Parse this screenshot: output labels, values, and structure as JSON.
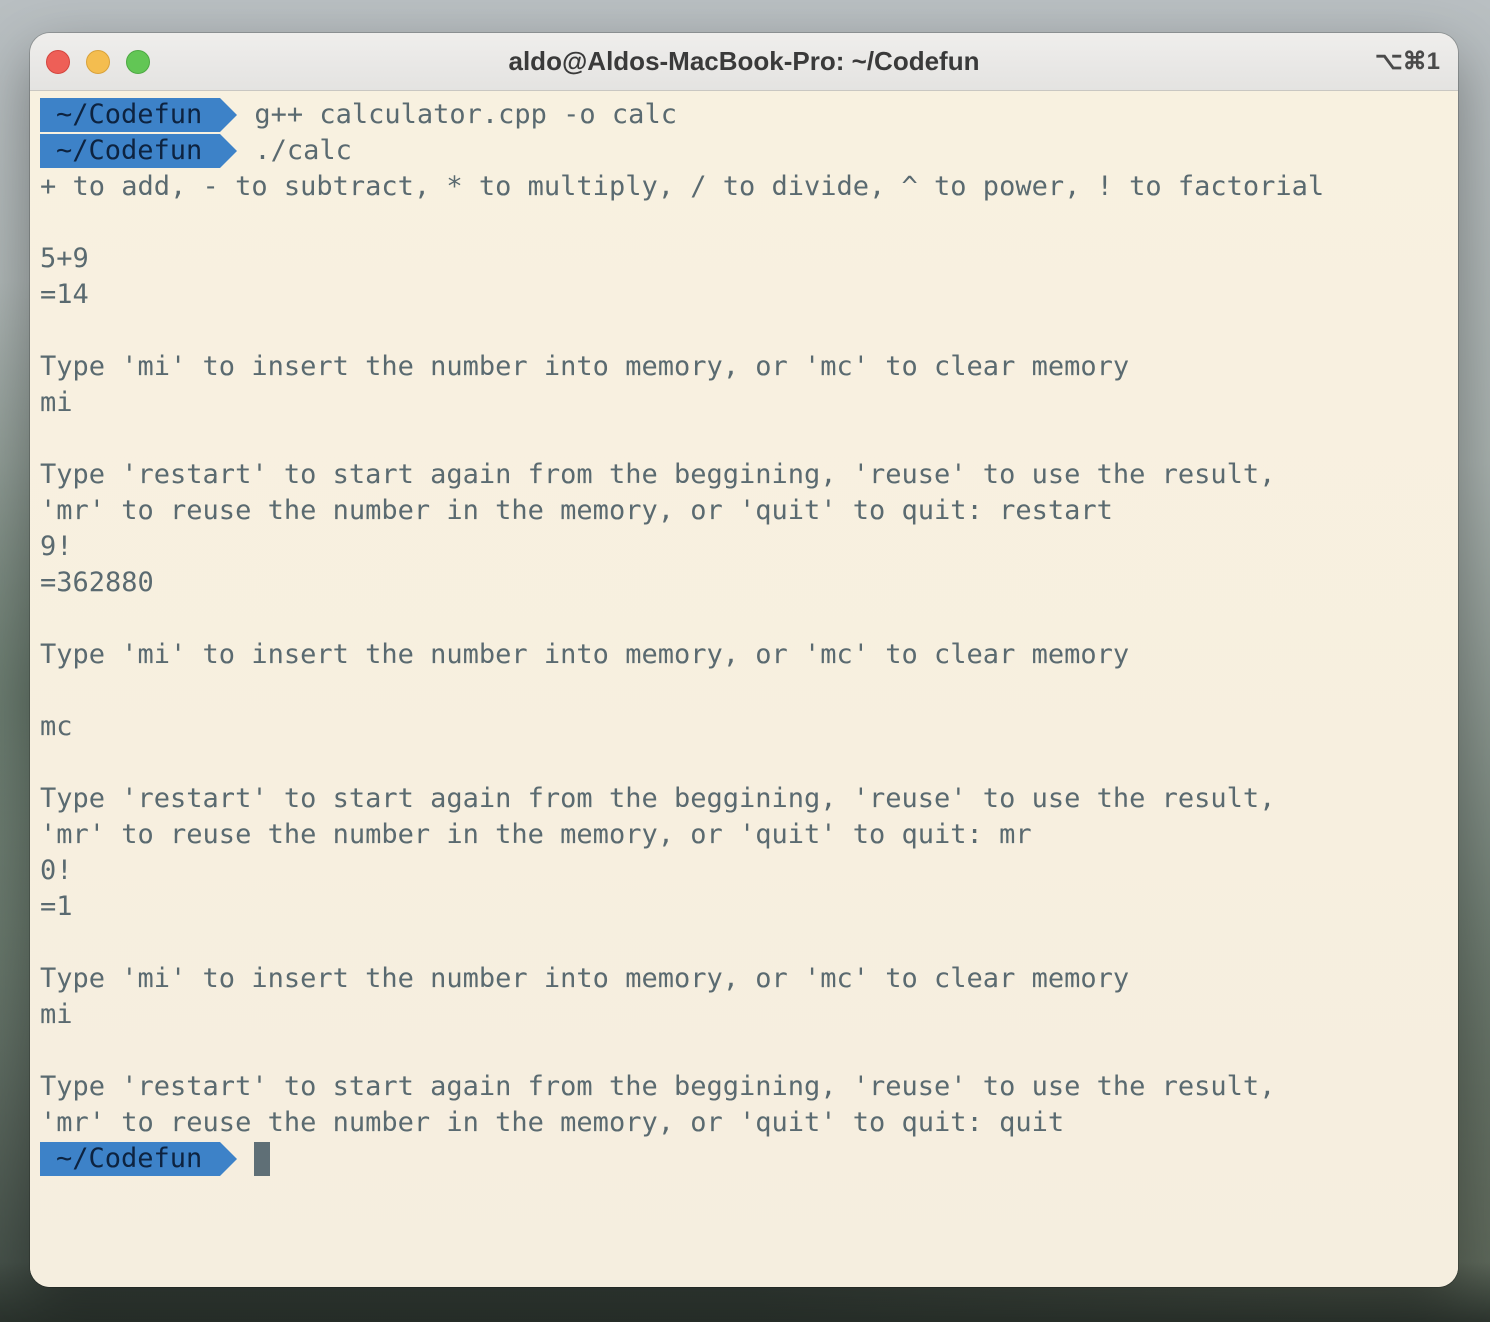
{
  "window": {
    "title": "aldo@Aldos-MacBook-Pro: ~/Codefun",
    "shortcut": "⌥⌘1"
  },
  "terminal": {
    "prompt": "~/Codefun",
    "lines": [
      {
        "kind": "prompt",
        "text": "g++ calculator.cpp -o calc"
      },
      {
        "kind": "prompt",
        "text": "./calc"
      },
      {
        "kind": "output",
        "text": "+ to add, - to subtract, * to multiply, / to divide, ^ to power, ! to factorial"
      },
      {
        "kind": "output",
        "text": ""
      },
      {
        "kind": "output",
        "text": "5+9"
      },
      {
        "kind": "output",
        "text": "=14"
      },
      {
        "kind": "output",
        "text": ""
      },
      {
        "kind": "output",
        "text": "Type 'mi' to insert the number into memory, or 'mc' to clear memory"
      },
      {
        "kind": "output",
        "text": "mi"
      },
      {
        "kind": "output",
        "text": ""
      },
      {
        "kind": "output",
        "text": "Type 'restart' to start again from the beggining, 'reuse' to use the result,"
      },
      {
        "kind": "output",
        "text": "'mr' to reuse the number in the memory, or 'quit' to quit: restart"
      },
      {
        "kind": "output",
        "text": "9!"
      },
      {
        "kind": "output",
        "text": "=362880"
      },
      {
        "kind": "output",
        "text": ""
      },
      {
        "kind": "output",
        "text": "Type 'mi' to insert the number into memory, or 'mc' to clear memory"
      },
      {
        "kind": "output",
        "text": ""
      },
      {
        "kind": "output",
        "text": "mc"
      },
      {
        "kind": "output",
        "text": ""
      },
      {
        "kind": "output",
        "text": "Type 'restart' to start again from the beggining, 'reuse' to use the result,"
      },
      {
        "kind": "output",
        "text": "'mr' to reuse the number in the memory, or 'quit' to quit: mr"
      },
      {
        "kind": "output",
        "text": "0!"
      },
      {
        "kind": "output",
        "text": "=1"
      },
      {
        "kind": "output",
        "text": ""
      },
      {
        "kind": "output",
        "text": "Type 'mi' to insert the number into memory, or 'mc' to clear memory"
      },
      {
        "kind": "output",
        "text": "mi"
      },
      {
        "kind": "output",
        "text": ""
      },
      {
        "kind": "output",
        "text": "Type 'restart' to start again from the beggining, 'reuse' to use the result,"
      },
      {
        "kind": "output",
        "text": "'mr' to reuse the number in the memory, or 'quit' to quit: quit"
      },
      {
        "kind": "cursor",
        "text": ""
      }
    ]
  },
  "colors": {
    "prompt_bg": "#3d82c8",
    "prompt_fg": "#0d2340",
    "text": "#5a6a70",
    "terminal_bg": "#f8f1e0"
  }
}
